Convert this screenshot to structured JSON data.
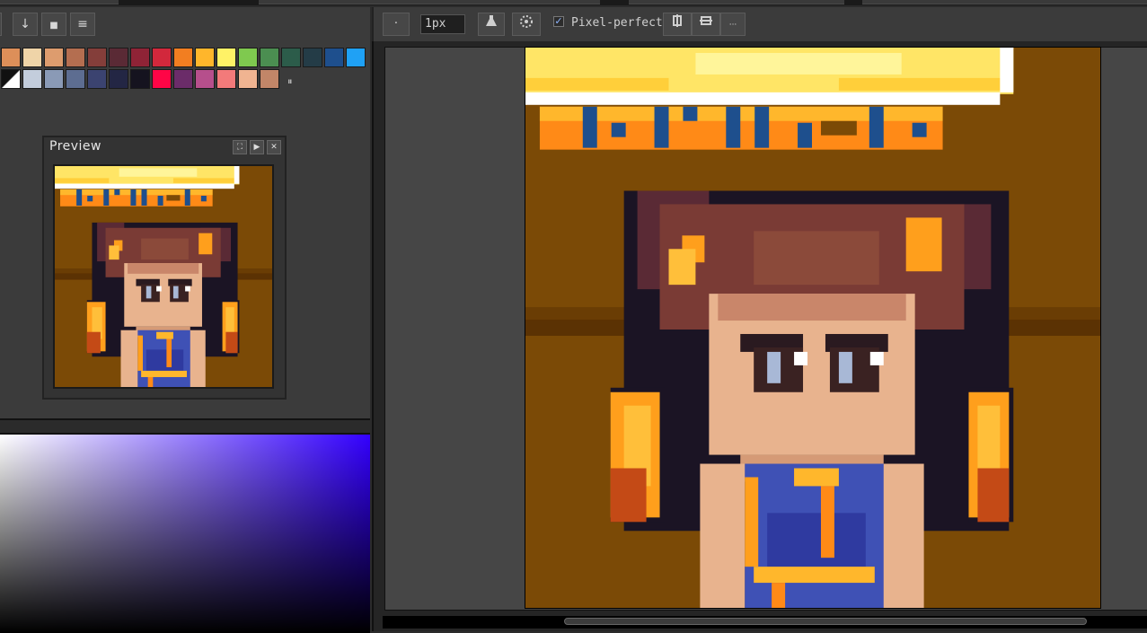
{
  "left_toolbar": {
    "buttons": [
      {
        "name": "down-arrow-icon",
        "glyph": "↓"
      },
      {
        "name": "page-icon",
        "glyph": "■"
      },
      {
        "name": "menu-icon",
        "glyph": "≡"
      }
    ]
  },
  "palette": {
    "row1": [
      "#dd8f59",
      "#efd4a8",
      "#dd9c6e",
      "#b46e50",
      "#843e3a",
      "#5a2a35",
      "#8f2336",
      "#d2283c",
      "#f27e21",
      "#ffb62b",
      "#fff266",
      "#7fc94f",
      "#4b8e51",
      "#2c5c4a",
      "#243c47",
      "#1e4f8d",
      "#1fa1f5"
    ],
    "row2": [
      "#ffffff",
      "#c3cddc",
      "#8a9ab6",
      "#5d6d91",
      "#3b4370",
      "#232644",
      "#15131f",
      "#ff0546",
      "#6b2c69",
      "#b64f8c",
      "#f37a7a",
      "#f0b491",
      "#c28668"
    ],
    "grip": "⏸"
  },
  "preview": {
    "title": "Preview",
    "buttons": [
      "⛶",
      "▶",
      "✕"
    ]
  },
  "right_toolbar": {
    "dot_button": "·",
    "brush_size": "1px",
    "pixel_perfect_checked": true,
    "pixel_perfect_label": "Pixel-perfect",
    "more_button": "···",
    "check_glyph": "✓"
  },
  "colors": {
    "accent": "#8fb5ff",
    "canvas_background": "#7b4a06"
  }
}
